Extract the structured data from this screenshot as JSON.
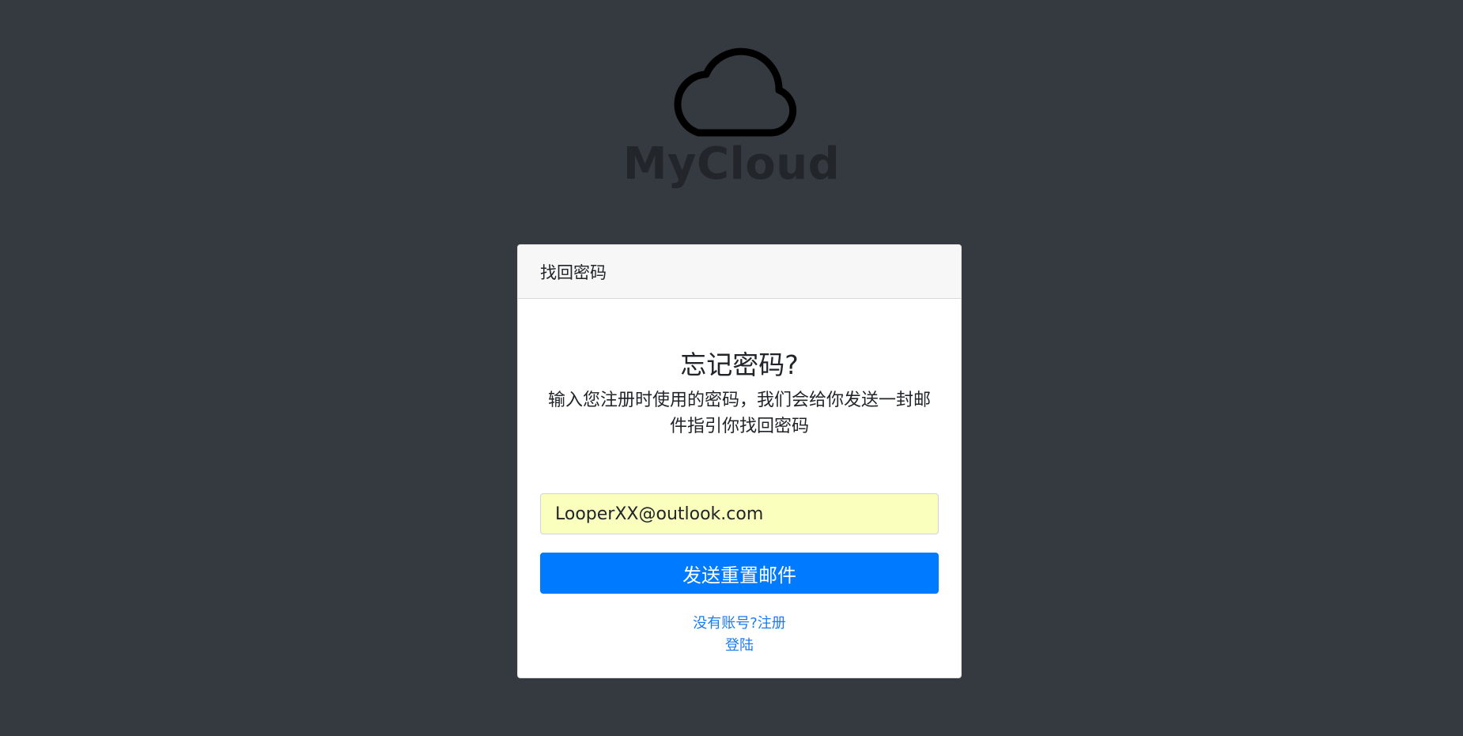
{
  "brand": {
    "name": "MyCloud",
    "logo_icon": "cloud-icon"
  },
  "card": {
    "header_title": "找回密码",
    "heading": "忘记密码?",
    "description": "输入您注册时使用的密码，我们会给你发送一封邮件指引你找回密码"
  },
  "form": {
    "email_value": "LooperXX@outlook.com",
    "submit_label": "发送重置邮件"
  },
  "links": {
    "register_label": "没有账号?注册",
    "login_label": "登陆"
  },
  "colors": {
    "background": "#343a40",
    "primary": "#007bff",
    "autofill": "#faffbd",
    "link": "#1a7cf0"
  }
}
